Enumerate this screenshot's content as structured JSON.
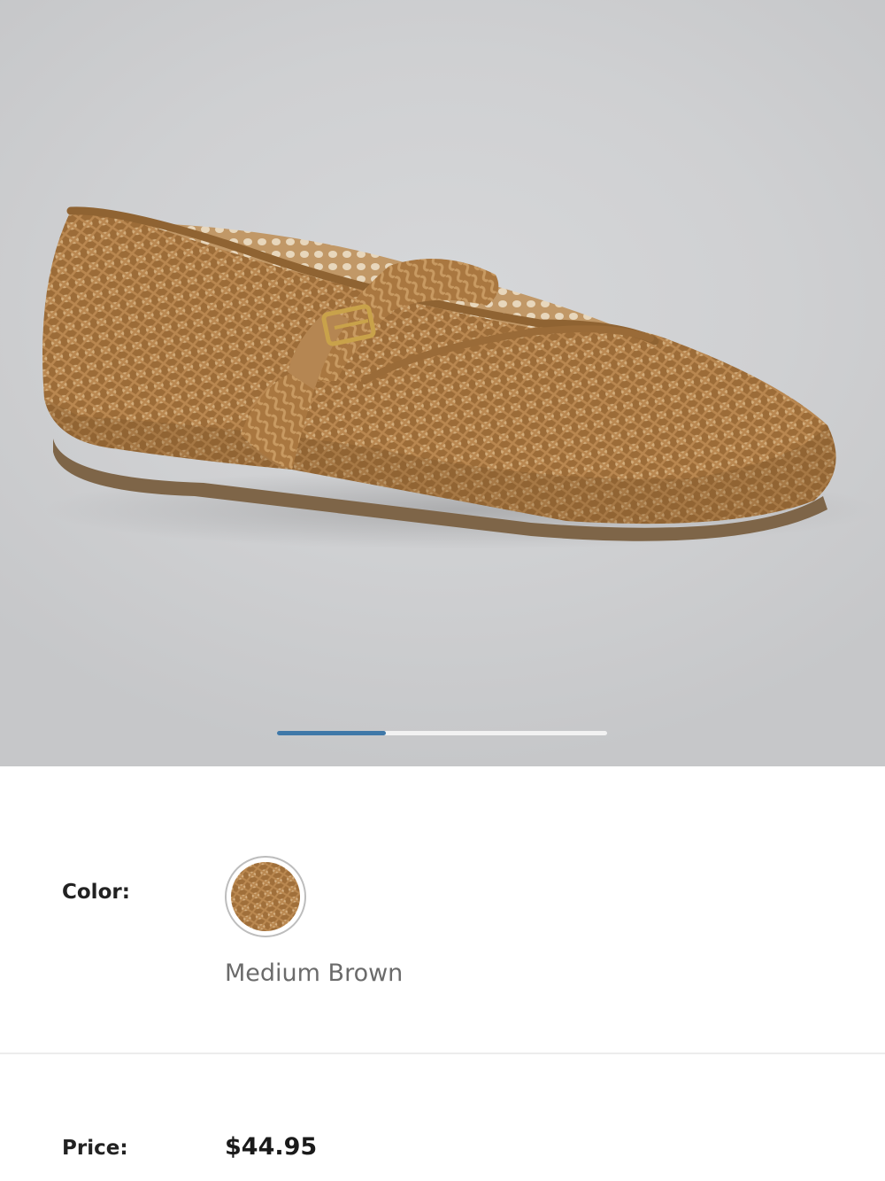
{
  "product": {
    "image_alt": "Medium Brown woven mary jane flat",
    "gallery": {
      "current_index": 1,
      "progress": 0.33
    }
  },
  "color": {
    "label": "Color:",
    "selected_name": "Medium Brown",
    "swatch_color": "#b07d46"
  },
  "price": {
    "label": "Price:",
    "value": "$44.95"
  },
  "colors": {
    "accent": "#3f78a8",
    "shoe_body": "#b07d46",
    "shoe_shadow": "#8a5c2c",
    "background": "#cfd0d2"
  }
}
